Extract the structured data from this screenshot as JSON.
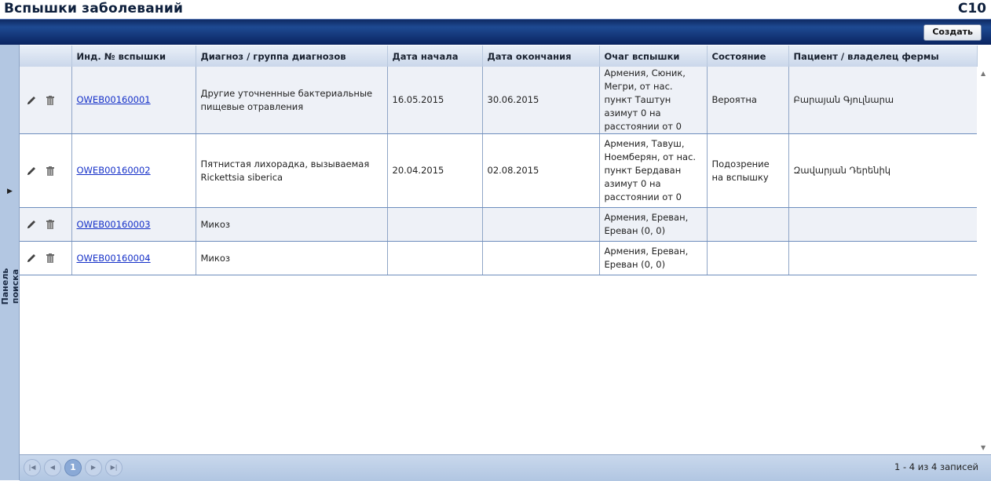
{
  "header": {
    "title": "Вспышки заболеваний",
    "code": "C10",
    "create_label": "Создать"
  },
  "side_panel": {
    "label": "Панель поиска",
    "arrow": "▶"
  },
  "table": {
    "columns": [
      "",
      "Инд. № вспышки",
      "Диагноз / группа диагнозов",
      "Дата начала",
      "Дата окончания",
      "Очаг вспышки",
      "Состояние",
      "Пациент / владелец фермы"
    ],
    "rows": [
      {
        "id": "OWEB00160001",
        "diagnosis": "Другие уточненные бактериальные пищевые отравления",
        "start": "16.05.2015",
        "end": "30.06.2015",
        "location": "Армения, Сюник, Мегри, от нас. пункт Таштун азимут 0 на расстоянии от 0",
        "status": "Вероятна",
        "patient": "Բարայան Գյուլնարա"
      },
      {
        "id": "OWEB00160002",
        "diagnosis": "Пятнистая лихорадка, вызываемая Rickettsia siberica",
        "start": "20.04.2015",
        "end": "02.08.2015",
        "location": "Армения, Тавуш, Ноемберян, от нас. пункт Бердаван азимут 0 на расстоянии от 0",
        "status": "Подозрение на вспышку",
        "patient": "Զավարյան Դերենիկ"
      },
      {
        "id": "OWEB00160003",
        "diagnosis": "Микоз",
        "start": "",
        "end": "",
        "location": "Армения, Ереван, Ереван (0, 0)",
        "status": "",
        "patient": ""
      },
      {
        "id": "OWEB00160004",
        "diagnosis": "Микоз",
        "start": "",
        "end": "",
        "location": "Армения, Ереван, Ереван (0, 0)",
        "status": "",
        "patient": ""
      }
    ]
  },
  "pagination": {
    "current_page": "1",
    "records_text": "1 - 4 из 4 записей"
  },
  "icons": [
    "pencil-icon",
    "trash-icon",
    "first-page-icon",
    "prev-page-icon",
    "next-page-icon",
    "last-page-icon",
    "scroll-up-icon",
    "scroll-down-icon"
  ]
}
